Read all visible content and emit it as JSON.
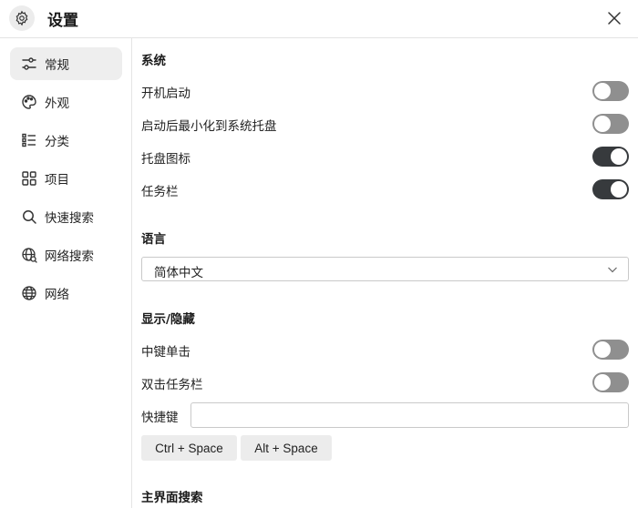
{
  "window": {
    "title": "设置",
    "icon": "gear-icon",
    "close_icon": "close-icon"
  },
  "sidebar": {
    "items": [
      {
        "label": "常规",
        "icon": "sliders-icon",
        "active": true
      },
      {
        "label": "外观",
        "icon": "palette-icon",
        "active": false
      },
      {
        "label": "分类",
        "icon": "list-icon",
        "active": false
      },
      {
        "label": "项目",
        "icon": "grid-icon",
        "active": false
      },
      {
        "label": "快速搜索",
        "icon": "search-icon",
        "active": false
      },
      {
        "label": "网络搜索",
        "icon": "globe-search-icon",
        "active": false
      },
      {
        "label": "网络",
        "icon": "globe-icon",
        "active": false
      }
    ]
  },
  "main": {
    "system": {
      "title": "系统",
      "items": [
        {
          "label": "开机启动",
          "on": false
        },
        {
          "label": "启动后最小化到系统托盘",
          "on": false
        },
        {
          "label": "托盘图标",
          "on": true
        },
        {
          "label": "任务栏",
          "on": true
        }
      ]
    },
    "language": {
      "title": "语言",
      "selected": "简体中文"
    },
    "show_hide": {
      "title": "显示/隐藏",
      "items": [
        {
          "label": "中键单击",
          "on": false
        },
        {
          "label": "双击任务栏",
          "on": false
        }
      ],
      "hotkey_label": "快捷键",
      "hotkey_value": "",
      "hotkey_presets": [
        "Ctrl + Space",
        "Alt + Space"
      ]
    },
    "main_search": {
      "title": "主界面搜索"
    }
  },
  "colors": {
    "toggle_on": "#373a3d",
    "toggle_off": "#8f8f8f",
    "active_nav_bg": "#eeeeee",
    "border": "#e4e4e4"
  }
}
